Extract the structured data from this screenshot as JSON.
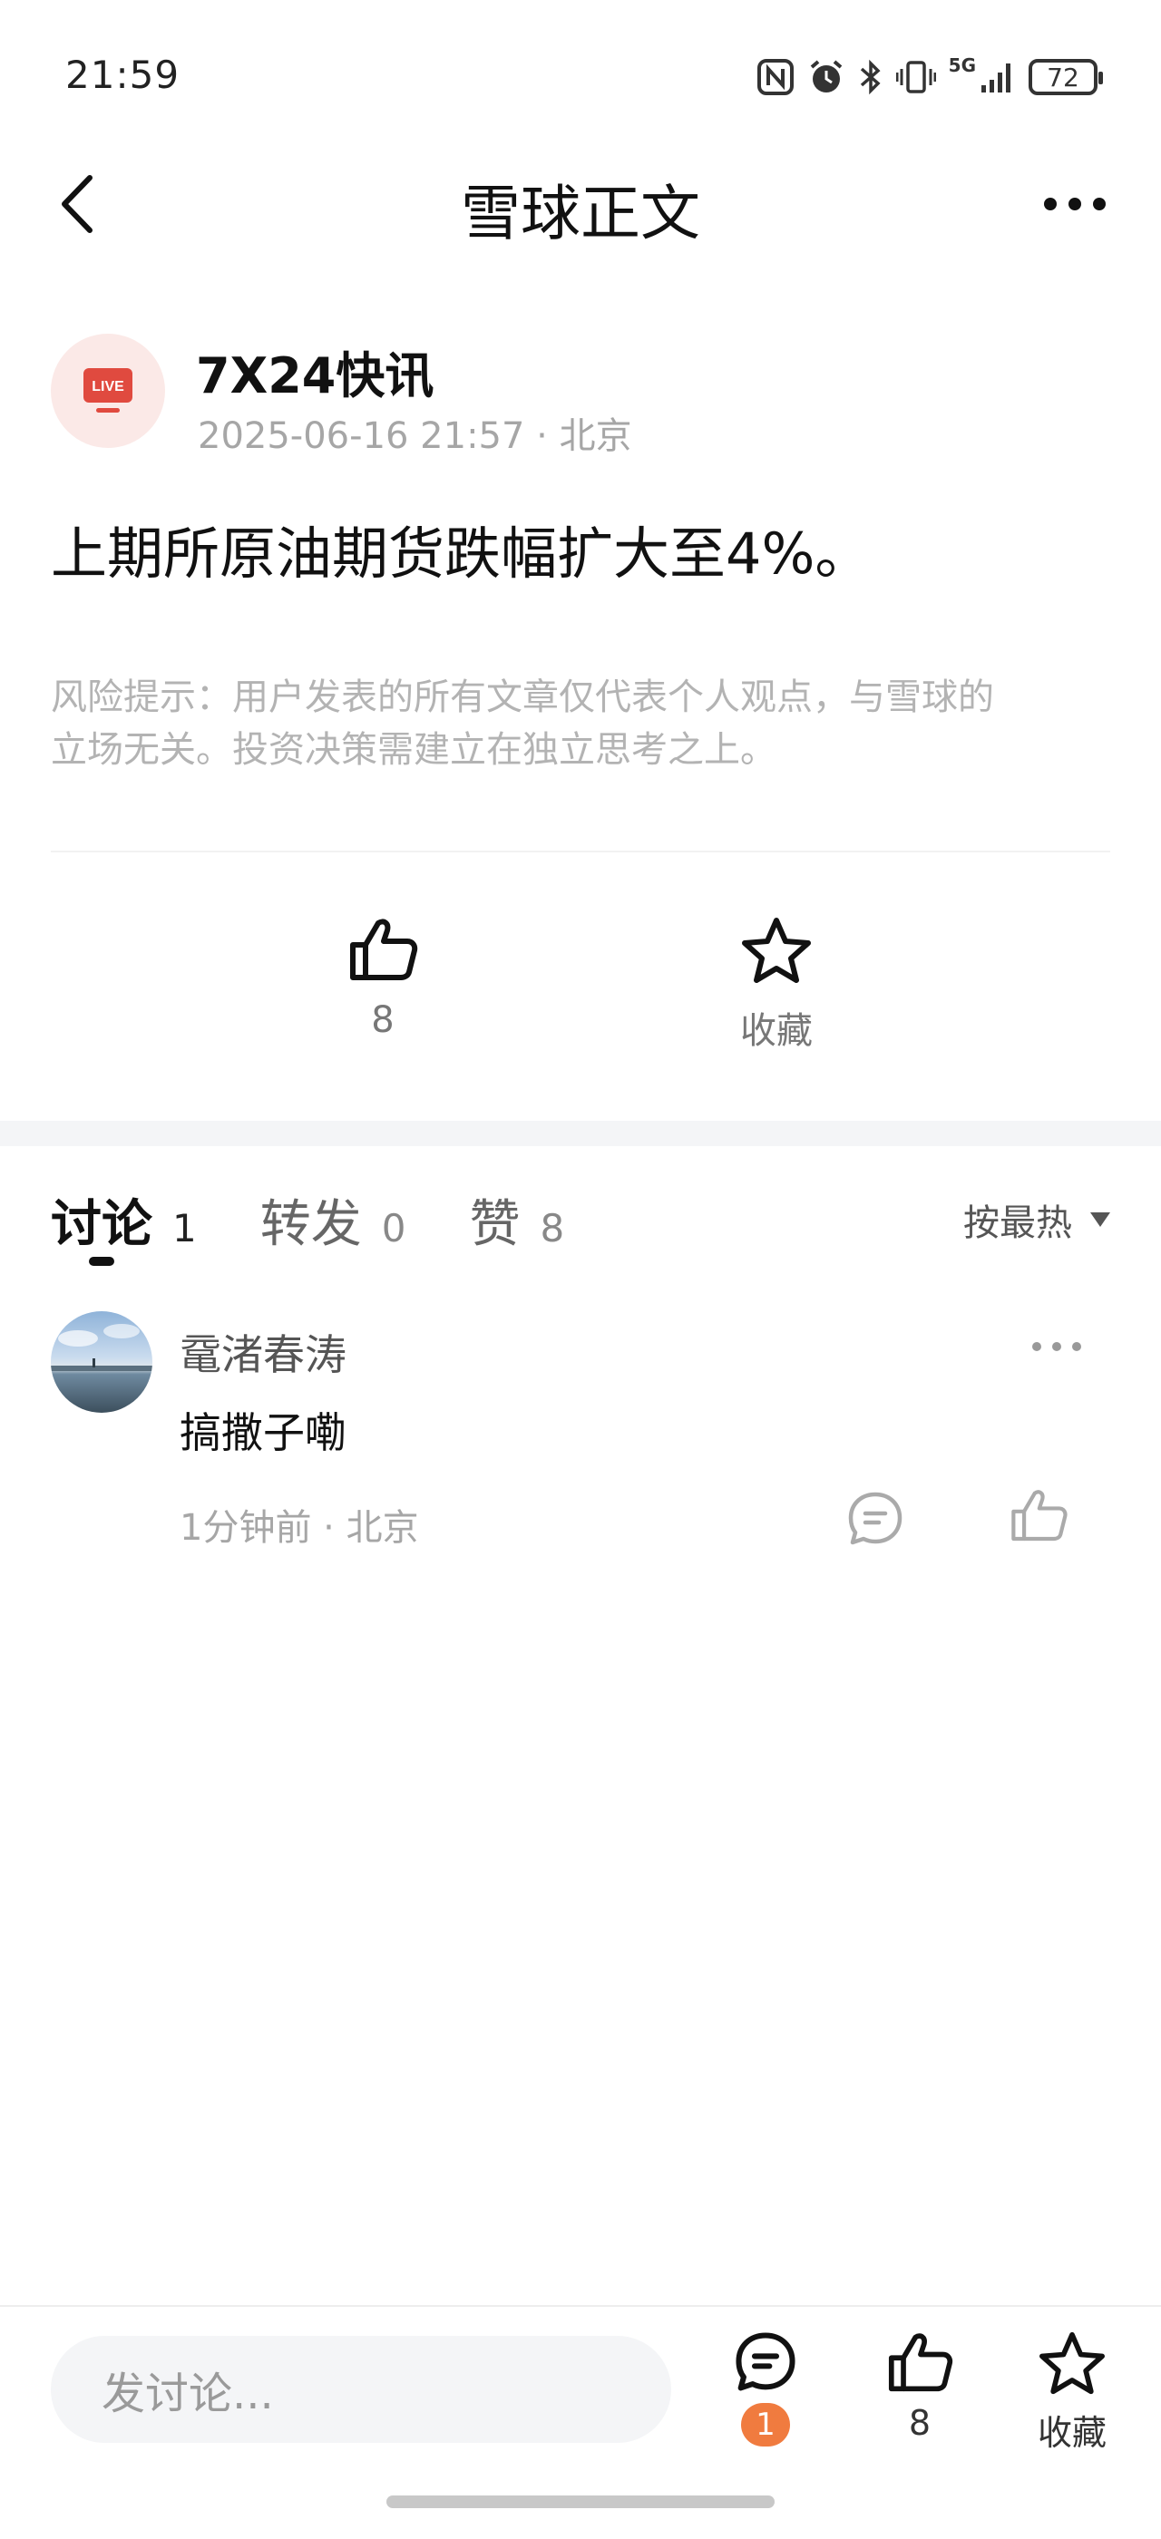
{
  "status_bar": {
    "time": "21:59",
    "signal": "5G",
    "battery": "72",
    "icons": [
      "nfc-icon",
      "alarm-icon",
      "bluetooth-icon",
      "vibrate-icon",
      "signal-icon",
      "battery-icon"
    ]
  },
  "header": {
    "title": "雪球正文",
    "back_icon": "chevron-left-icon",
    "more_icon": "more-horizontal-icon"
  },
  "post": {
    "author": "7X24快讯",
    "avatar_label": "LIVE",
    "datetime": "2025-06-16 21:57",
    "location": "北京",
    "content": "上期所原油期货跌幅扩大至4%。",
    "risk_line1": "风险提示：用户发表的所有文章仅代表个人观点，与雪球的",
    "risk_line2": "立场无关。投资决策需建立在独立思考之上。"
  },
  "actions": {
    "like_count": "8",
    "favorite_label": "收藏"
  },
  "tabs": [
    {
      "label": "讨论",
      "count": "1",
      "active": true
    },
    {
      "label": "转发",
      "count": "0",
      "active": false
    },
    {
      "label": "赞",
      "count": "8",
      "active": false
    }
  ],
  "sort_label": "按最热",
  "comments": [
    {
      "user": "鼋渚春涛",
      "text": "搞撒子嘞",
      "time": "1分钟前",
      "location": "北京"
    }
  ],
  "bottom_bar": {
    "placeholder": "发讨论...",
    "comment_badge": "1",
    "like_count": "8",
    "favorite_label": "收藏"
  },
  "colors": {
    "accent_orange": "#f07b3f",
    "live_red": "#e04a3f",
    "muted_text": "#a6a6a6"
  }
}
